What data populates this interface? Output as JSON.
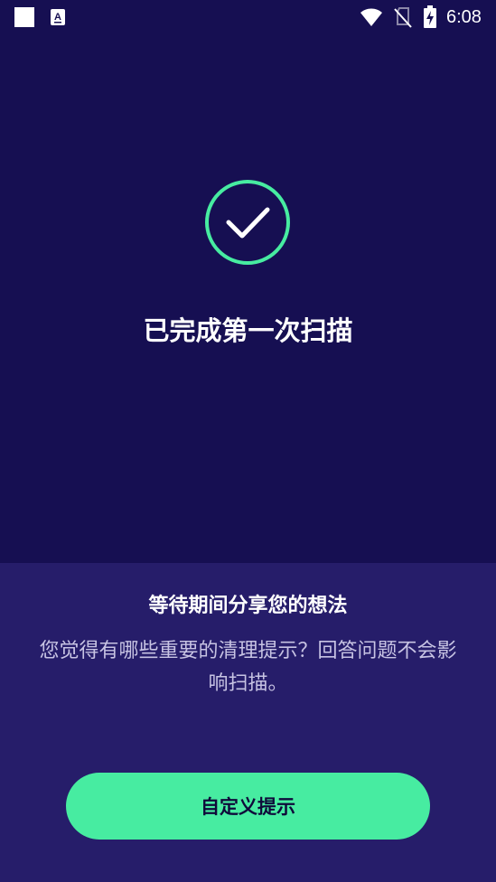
{
  "status_bar": {
    "time": "6:08",
    "icons": [
      "notification-square-icon",
      "font-a-app-icon",
      "wifi-icon",
      "no-sim-icon",
      "battery-charging-icon"
    ]
  },
  "colors": {
    "background_top": "#160f52",
    "background_bottom": "#261d6a",
    "accent_green": "#47eca1",
    "text_primary": "#ffffff",
    "text_secondary": "#c7c3e3"
  },
  "scan_result": {
    "icon": "check-circle-icon",
    "title": "已完成第一次扫描"
  },
  "feedback": {
    "title": "等待期间分享您的想法",
    "body": "您觉得有哪些重要的清理提示？回答问题不会影响扫描。",
    "button_label": "自定义提示"
  }
}
